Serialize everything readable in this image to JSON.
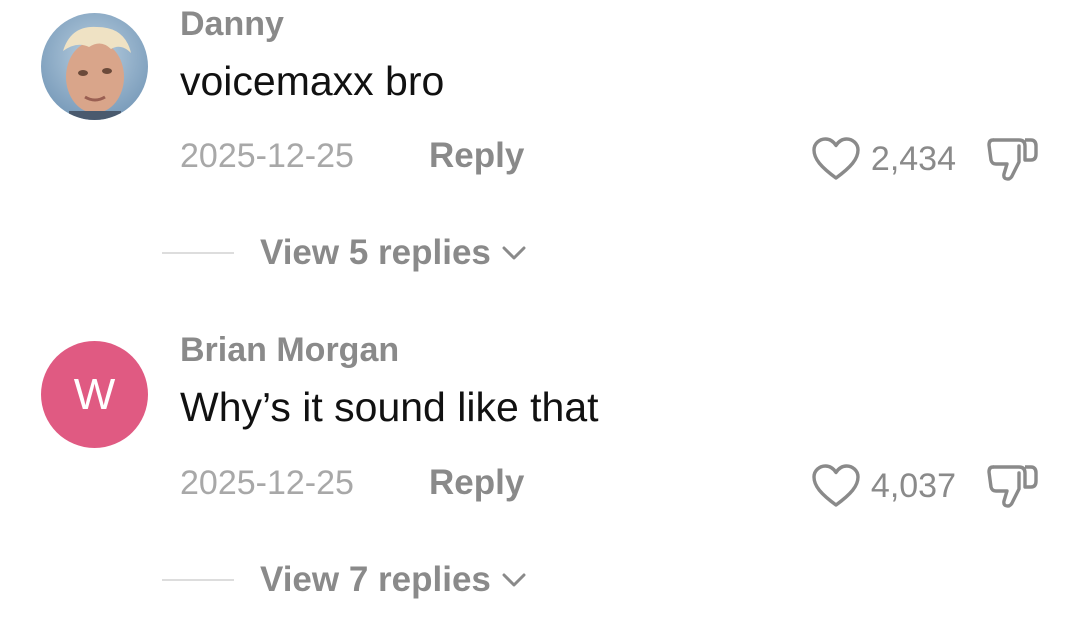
{
  "comments": [
    {
      "username": "Danny",
      "text": "voicemaxx bro",
      "date": "2025-12-25",
      "reply_label": "Reply",
      "likes": "2,434",
      "view_replies": "View 5 replies",
      "avatar_type": "photo"
    },
    {
      "username": "Brian Morgan",
      "text": "Why’s it sound like that",
      "date": "2025-12-25",
      "reply_label": "Reply",
      "likes": "4,037",
      "view_replies": "View 7 replies",
      "avatar_type": "letter",
      "avatar_letter": "W",
      "avatar_color": "#e05a82"
    }
  ],
  "colors": {
    "muted": "#8a8a8a",
    "date": "#a8a8a8",
    "text": "#111111"
  },
  "icons": [
    "heart-icon",
    "dislike-icon",
    "chevron-down-icon"
  ]
}
